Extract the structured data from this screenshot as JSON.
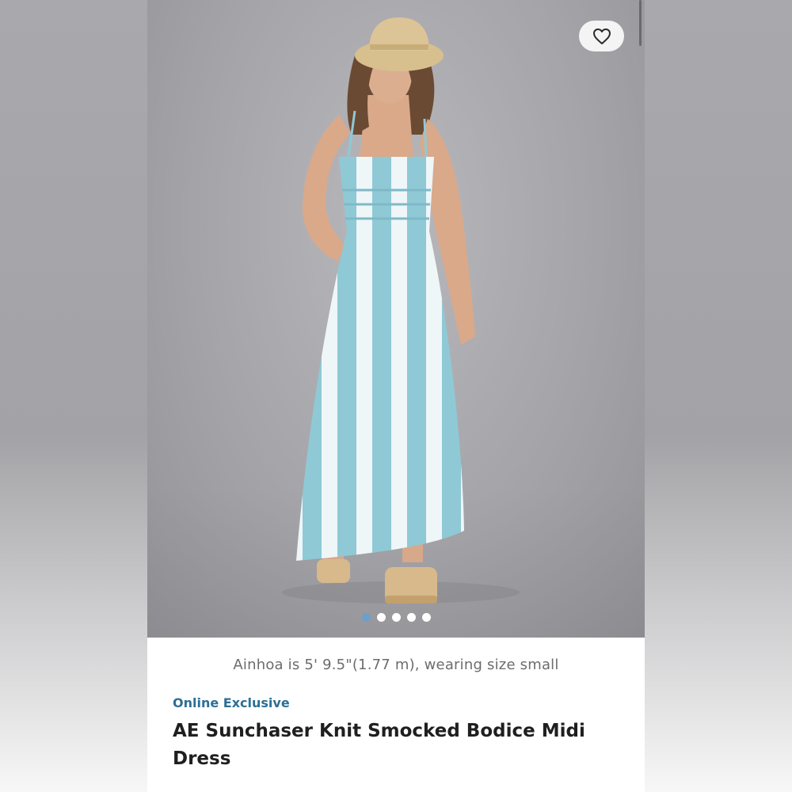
{
  "product": {
    "model_caption": "Ainhoa is 5' 9.5\"(1.77 m), wearing size small",
    "badge": "Online Exclusive",
    "title": "AE Sunchaser Knit Smocked Bodice Midi Dress"
  },
  "gallery": {
    "image_count": 5,
    "active_index": 0
  },
  "icons": {
    "favorite": "heart-outline-icon"
  },
  "colors": {
    "badge": "#2d6f94",
    "active_dot": "#6f9fc9",
    "dress_stripe": "#8fc9d6"
  }
}
